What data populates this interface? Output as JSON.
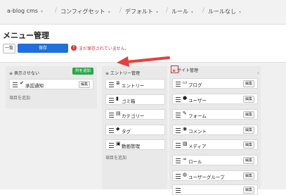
{
  "breadcrumb": [
    {
      "label": "a-blog cms",
      "caret": "▾"
    },
    {
      "label": "コンフィグセット",
      "caret": "▾"
    },
    {
      "label": "デフォルト",
      "caret": "▾"
    },
    {
      "label": "ルール",
      "caret": "▾"
    },
    {
      "label": "ルールなし",
      "caret": "▾"
    }
  ],
  "page_title": "メニュー管理",
  "toolbar": {
    "list_label": "一覧",
    "save_label": "保存",
    "warning": "まだ保存されていません。"
  },
  "columns": {
    "hidden": {
      "title": "表示させない",
      "add_column_label": "列を追加",
      "items": [
        {
          "label": "承認通知",
          "icon": "check-icon",
          "glyph": "✔",
          "edit": "編集"
        }
      ],
      "add_item_label": "項目を追加"
    },
    "entry": {
      "title": "エントリー管理",
      "items": [
        {
          "label": "エントリー",
          "icon": "list-icon",
          "glyph": "≣",
          "edit": "編集"
        },
        {
          "label": "ゴミ箱",
          "icon": "trash-icon",
          "glyph": "▮",
          "edit": "編集"
        },
        {
          "label": "カテゴリー",
          "icon": "category-icon",
          "glyph": "▤",
          "edit": "編集"
        },
        {
          "label": "タグ",
          "icon": "tag-icon",
          "glyph": "◆",
          "edit": "編集"
        },
        {
          "label": "動画管理",
          "icon": "video-icon",
          "glyph": "▣",
          "edit": "編集"
        }
      ],
      "add_item_label": "項目を追加"
    },
    "site": {
      "title": "サイト管理",
      "close": "×",
      "items": [
        {
          "label": "ブログ",
          "icon": "folder-icon",
          "glyph": "▭",
          "edit": "編集"
        },
        {
          "label": "ユーザー",
          "icon": "user-icon",
          "glyph": "●",
          "edit": "編集"
        },
        {
          "label": "フォーム",
          "icon": "form-icon",
          "glyph": "✎",
          "edit": "編集"
        },
        {
          "label": "コメント",
          "icon": "comment-icon",
          "glyph": "◉",
          "edit": "編集"
        },
        {
          "label": "メディア",
          "icon": "media-icon",
          "glyph": "▧",
          "edit": "編集"
        },
        {
          "label": "ロール",
          "icon": "role-icon",
          "glyph": "∞",
          "edit": "編集"
        },
        {
          "label": "ユーザーグループ",
          "icon": "user-group-icon",
          "glyph": "◍",
          "edit": "編集"
        },
        {
          "label": "",
          "icon": "more-icon",
          "glyph": "",
          "edit": "編集"
        }
      ]
    }
  },
  "colors": {
    "save": "#1f70d8",
    "warning": "#d9303a",
    "add_column": "#2aa84a",
    "arrow": "#e8403a"
  }
}
